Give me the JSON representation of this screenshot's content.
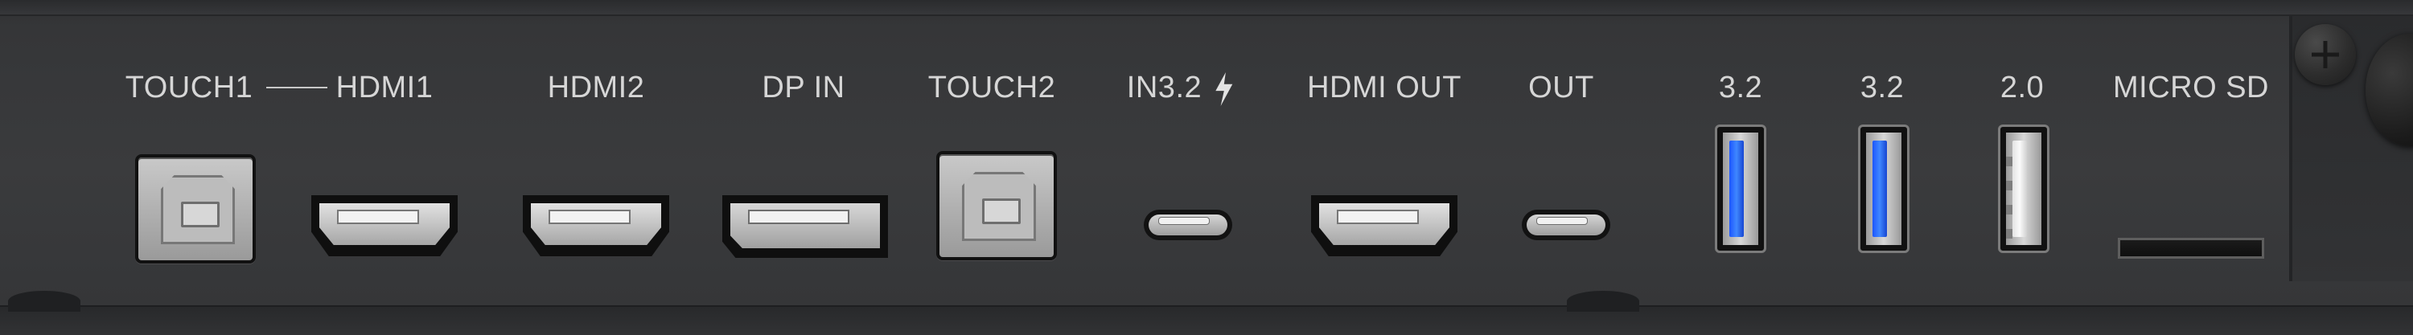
{
  "panel": {
    "labels": {
      "touch1": "TOUCH1",
      "hdmi1": "HDMI1",
      "hdmi2": "HDMI2",
      "dp_in": "DP IN",
      "touch2": "TOUCH2",
      "in32": "IN3.2",
      "hdmi_out": "HDMI OUT",
      "out": "OUT",
      "usb32_a": "3.2",
      "usb32_b": "3.2",
      "usb20": "2.0",
      "micro_sd": "MICRO SD"
    },
    "icons": {
      "bolt": "lightning-bolt-icon"
    },
    "colors": {
      "panel": "#3a3b3d",
      "label": "#d6d6d6",
      "usb3_blue": "#2f6bff",
      "metal": "#bcbcbc"
    }
  }
}
